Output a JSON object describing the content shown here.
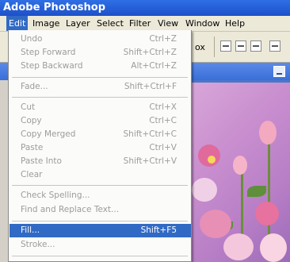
{
  "window": {
    "title": "Adobe Photoshop"
  },
  "menubar": {
    "items": [
      {
        "label": "Edit",
        "active": true
      },
      {
        "label": "Image"
      },
      {
        "label": "Layer"
      },
      {
        "label": "Select"
      },
      {
        "label": "Filter"
      },
      {
        "label": "View"
      },
      {
        "label": "Window"
      },
      {
        "label": "Help"
      }
    ]
  },
  "toolbar": {
    "partial_label": "ox"
  },
  "edit_menu": {
    "items": [
      {
        "label": "Undo",
        "shortcut": "Ctrl+Z",
        "enabled": false
      },
      {
        "label": "Step Forward",
        "shortcut": "Shift+Ctrl+Z",
        "enabled": false
      },
      {
        "label": "Step Backward",
        "shortcut": "Alt+Ctrl+Z",
        "enabled": false
      },
      {
        "label": "Fade...",
        "shortcut": "Shift+Ctrl+F",
        "enabled": false
      },
      {
        "label": "Cut",
        "shortcut": "Ctrl+X",
        "enabled": false
      },
      {
        "label": "Copy",
        "shortcut": "Ctrl+C",
        "enabled": false
      },
      {
        "label": "Copy Merged",
        "shortcut": "Shift+Ctrl+C",
        "enabled": false
      },
      {
        "label": "Paste",
        "shortcut": "Ctrl+V",
        "enabled": false
      },
      {
        "label": "Paste Into",
        "shortcut": "Shift+Ctrl+V",
        "enabled": false
      },
      {
        "label": "Clear",
        "shortcut": "",
        "enabled": false
      },
      {
        "label": "Check Spelling...",
        "shortcut": "",
        "enabled": false
      },
      {
        "label": "Find and Replace Text...",
        "shortcut": "",
        "enabled": false
      },
      {
        "label": "Fill...",
        "shortcut": "Shift+F5",
        "enabled": true,
        "highlighted": true
      },
      {
        "label": "Stroke...",
        "shortcut": "",
        "enabled": false
      }
    ]
  },
  "colors": {
    "title_bar": "#1d50c9",
    "menu_highlight": "#316ac5",
    "menu_background": "#fbfbf9",
    "disabled_text": "#9c9c9c",
    "canvas_background": "#c98fcf"
  },
  "icons": [
    "align-left-icon",
    "align-center-icon",
    "align-right-icon",
    "distribute-icon",
    "minimize-icon"
  ]
}
